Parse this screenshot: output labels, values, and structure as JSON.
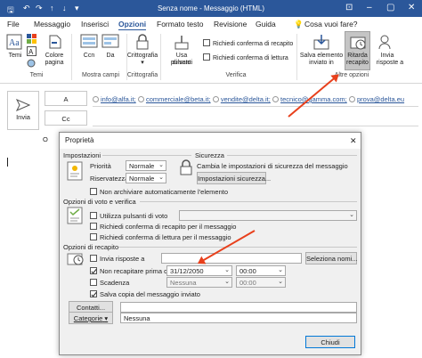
{
  "window": {
    "title": "Senza nome  -  Messaggio (HTML)"
  },
  "menu": {
    "tabs": [
      "File",
      "Messaggio",
      "Inserisci",
      "Opzioni",
      "Formato testo",
      "Revisione",
      "Guida"
    ],
    "search": "Cosa vuoi fare?"
  },
  "ribbon": {
    "temi": {
      "btn_temi": "Temi",
      "colore": "Colore",
      "pagina": "pagina",
      "group": "Temi"
    },
    "campi": {
      "ccn": "Ccn",
      "da": "Da",
      "group": "Mostra campi"
    },
    "crittografia": {
      "label": "Crittografia",
      "group": "Crittografia"
    },
    "verifica": {
      "usa_pulsanti_1": "Usa pulsanti",
      "usa_pulsanti_2": "di voto",
      "conferma_recapito": "Richiedi conferma di recapito",
      "conferma_lettura": "Richiedi conferma di lettura",
      "group": "Verifica"
    },
    "altre": {
      "salva_1": "Salva elemento",
      "salva_2": "inviato in",
      "ritarda_1": "Ritarda",
      "ritarda_2": "recapito",
      "invia_1": "Invia",
      "invia_2": "risposte a",
      "group": "Altre opzioni"
    }
  },
  "compose": {
    "send": "Invia",
    "to": "A",
    "cc": "Cc",
    "oggetto_prefix": "O",
    "recipients": [
      "info@alfa.it;",
      "commerciale@beta.it;",
      "vendite@delta.it;",
      "tecnico@gamma.com;",
      "prova@delta.eu"
    ]
  },
  "dialog": {
    "title": "Proprietà",
    "close": "✕",
    "impostazioni": {
      "header": "Impostazioni",
      "priorita_label": "Priorità",
      "priorita_value": "Normale",
      "riservatezza_label": "Riservatezza",
      "riservatezza_value": "Normale",
      "non_archiviare": "Non archiviare automaticamente l'elemento"
    },
    "sicurezza": {
      "header": "Sicurezza",
      "text": "Cambia le impostazioni di sicurezza del messaggio",
      "button": "Impostazioni sicurezza..."
    },
    "voto": {
      "header": "Opzioni di voto e verifica",
      "utilizza": "Utilizza pulsanti di voto",
      "conferma_recapito": "Richiedi conferma di recapito per il messaggio",
      "conferma_lettura": "Richiedi conferma di lettura per il messaggio"
    },
    "recapito": {
      "header": "Opzioni di recapito",
      "invia_risposte": "Invia risposte a",
      "seleziona": "Seleziona nomi...",
      "non_recapitare": "Non recapitare prima di",
      "data": "31/12/2050",
      "ora": "00:00",
      "scadenza": "Scadenza",
      "scad_data": "Nessuna",
      "scad_ora": "00:00",
      "salva_copia": "Salva copia del messaggio inviato"
    },
    "contatti": "Contatti...",
    "categorie": "Categorie",
    "categorie_value": "Nessuna",
    "chiudi": "Chiudi"
  }
}
